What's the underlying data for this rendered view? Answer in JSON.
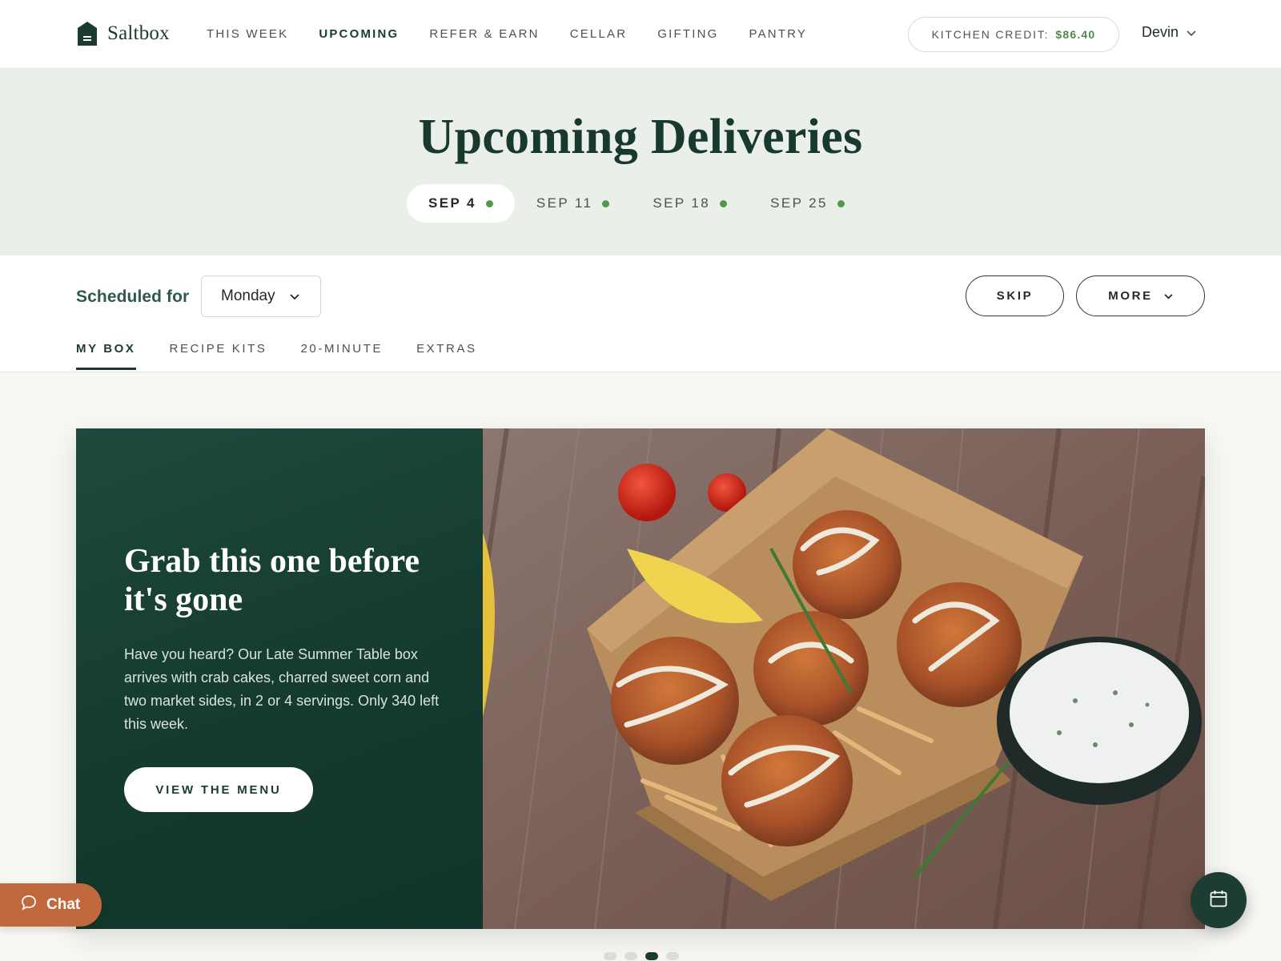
{
  "brand": {
    "name": "Saltbox",
    "logo_icon": "house-logo-icon",
    "accent": "#1b3b31"
  },
  "nav": {
    "links": [
      {
        "label": "THIS WEEK",
        "active": false
      },
      {
        "label": "UPCOMING",
        "active": true
      },
      {
        "label": "REFER & EARN",
        "active": false
      },
      {
        "label": "CELLAR",
        "active": false
      },
      {
        "label": "GIFTING",
        "active": false
      },
      {
        "label": "PANTRY",
        "active": false
      }
    ],
    "credit": {
      "label": "KITCHEN CREDIT:",
      "amount": "$86.40",
      "amount_color": "#4f8a4a"
    },
    "user": {
      "name": "Devin",
      "icon": "chevron-down-icon"
    }
  },
  "hero": {
    "title": "Upcoming Deliveries",
    "background": "#ebefea",
    "dates": [
      {
        "label": "SEP 4",
        "active": true
      },
      {
        "label": "SEP 11",
        "active": false
      },
      {
        "label": "SEP 18",
        "active": false
      },
      {
        "label": "SEP 25",
        "active": false
      }
    ],
    "dot_color": "#4f9a4a"
  },
  "schedule": {
    "label": "Scheduled for",
    "day": "Monday",
    "skip_label": "SKIP",
    "more_label": "MORE"
  },
  "tabs": [
    {
      "label": "MY BOX",
      "active": true
    },
    {
      "label": "RECIPE KITS",
      "active": false
    },
    {
      "label": "20-MINUTE",
      "active": false
    },
    {
      "label": "EXTRAS",
      "active": false
    }
  ],
  "promo": {
    "heading": "Grab this one before it's gone",
    "body": "Have you heard? Our Late Summer Table box arrives with crab cakes, charred sweet corn and two market sides, in 2 or 4 servings. Only 340 left this week.",
    "cta": "VIEW THE MENU",
    "panel_color": "#153a2f",
    "image_icon": "crab-cakes-photo"
  },
  "carousel": {
    "count": 4,
    "active_index": 2
  },
  "chat": {
    "label": "Chat",
    "icon": "speech-bubble-icon",
    "color": "#c1683c"
  },
  "fab": {
    "icon": "calendar-icon"
  }
}
